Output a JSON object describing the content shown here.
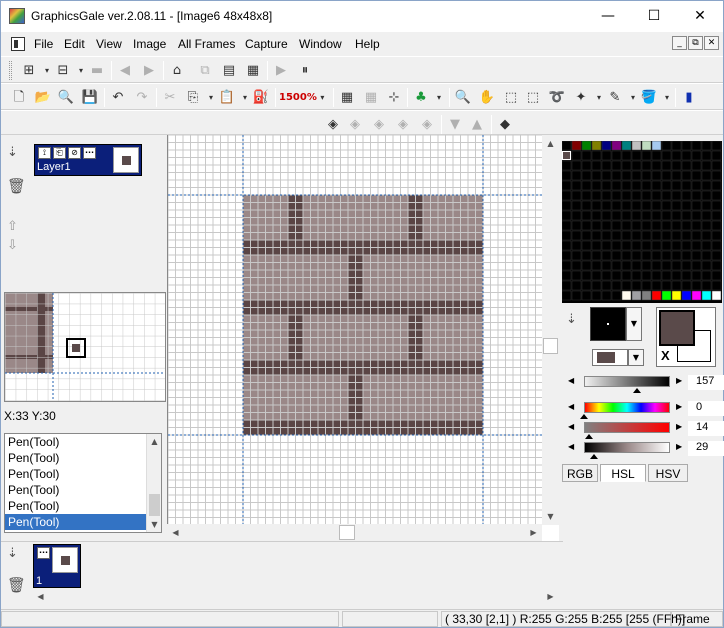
{
  "window": {
    "title": "GraphicsGale ver.2.08.11 - [Image6 48x48x8]",
    "minimize": "—",
    "maximize": "☐",
    "close": "✕"
  },
  "menu": {
    "items": [
      "File",
      "Edit",
      "View",
      "Image",
      "All Frames",
      "Capture",
      "Window",
      "Help"
    ]
  },
  "toolbar": {
    "zoom": "1500%"
  },
  "layers": {
    "name": "Layer1",
    "lock": "⟟",
    "visible_label": "···"
  },
  "preview": {
    "coords": "X:33 Y:30"
  },
  "history": {
    "items": [
      "Pen(Tool)",
      "Pen(Tool)",
      "Pen(Tool)",
      "Pen(Tool)",
      "Pen(Tool)",
      "Pen(Tool)"
    ],
    "selected_index": 5
  },
  "color": {
    "foreground": "#5a4a4a",
    "brick": "#9a8888",
    "mortar": "#5a4545",
    "x_label": "X",
    "sliders": [
      {
        "name": "lightness",
        "value": "157",
        "level": 0.62
      },
      {
        "name": "hue",
        "value": "0",
        "level": 0.0
      },
      {
        "name": "saturation",
        "value": "14",
        "level": 0.06
      },
      {
        "name": "luminance",
        "value": "29",
        "level": 0.12
      }
    ],
    "tabs": [
      "RGB",
      "HSL",
      "HSV"
    ],
    "active_tab": "HSL"
  },
  "frames": {
    "number": "1"
  },
  "status": {
    "pos": "( 33,30 [2,1] ) R:255 G:255 B:255",
    "index": "[255 (FFh)]",
    "frame": "Frame"
  },
  "palette_top": [
    "#000000",
    "#800000",
    "#008000",
    "#808000",
    "#000080",
    "#800080",
    "#008080",
    "#c0c0c0",
    "#c0dcc0",
    "#a6caf0",
    "#000000",
    "#000000",
    "#000000",
    "#000000",
    "#000000",
    "#000000"
  ],
  "palette_bottom": [
    "#fffbf0",
    "#a0a0a4",
    "#808080",
    "#ff0000",
    "#00ff00",
    "#ffff00",
    "#0000ff",
    "#ff00ff",
    "#00ffff",
    "#ffffff"
  ]
}
